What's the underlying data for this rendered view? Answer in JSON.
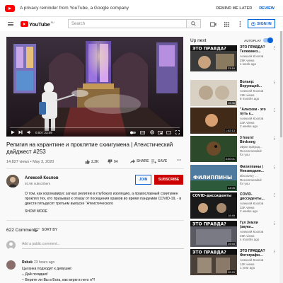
{
  "consent": {
    "message": "A privacy reminder from YouTube, a Google company",
    "remind_later": "REMIND ME LATER",
    "review": "REVIEW"
  },
  "masthead": {
    "logo_text": "YouTube",
    "logo_region": "RU",
    "search_placeholder": "Search",
    "sign_in": "SIGN IN"
  },
  "player": {
    "timecode": "0:00 / 23:49",
    "progress_fraction": 0.0
  },
  "video": {
    "title": "Религия на карантине и проклятие схиигумена | Атеистический дайджест #253",
    "meta": "14,827 views • May 3, 2020",
    "likes": "2.3K",
    "dislikes": "94",
    "share": "SHARE",
    "save": "SAVE"
  },
  "channel": {
    "name": "Алексей Козлов",
    "subscribers": "40.9K subscribers",
    "join": "JOIN",
    "subscribe": "SUBSCRIBE",
    "description": "О том, как коронавирус загнал религию в глубокую изоляцию, а православный схиигумен проклял тех, кто призывал к отказу от посещения храмов во время пандемии COVID-19, - в двести пятьдесят третьем выпуске \"Атеистического",
    "show_more": "SHOW MORE"
  },
  "comments": {
    "count": "622 Comments",
    "sort_by": "SORT BY",
    "placeholder": "Add a public comment...",
    "first": {
      "author": "Rebek",
      "time": "23 hours ago",
      "lines": [
        "Цыганка подходит к девушке:",
        "– Дай погадаю!",
        "– Верите ли Вы в Бога, как верю в него я?!"
      ]
    }
  },
  "sidebar": {
    "up_next": "Up next",
    "autoplay": "AUTOPLAY",
    "autoplay_on": true,
    "items": [
      {
        "title": "ЭТО ПРАВДА? Телекинез...",
        "channel": "Алексей Козлов",
        "views": "29K views",
        "age": "1 week ago",
        "duration": "23:18"
      },
      {
        "title": "Вольер: Верующий...",
        "channel": "Алексей Козлов",
        "views": "19K views",
        "age": "6 months ago",
        "duration": "15:36"
      },
      {
        "title": "\"Алисизм - это путь к...",
        "channel": "Алексей Козлов",
        "views": "33K views",
        "age": "2 weeks ago",
        "duration": "1:02:13"
      },
      {
        "title": "3 hours! Birdsong",
        "channel": "Звуки природ...",
        "views": "Recommended",
        "age": "for you",
        "duration": "3:00:01"
      },
      {
        "title": "Филиппины | Неизведанн...",
        "channel": "Discovery ...",
        "views": "Recommended",
        "age": "for you",
        "duration": "44:05"
      },
      {
        "title": "COVID-диссиденты...",
        "channel": "Алексей Козлов",
        "views": "33K views",
        "age": "2 weeks ago",
        "duration": "16:49"
      },
      {
        "title": "Гул Земли (звуки...",
        "channel": "Алексей Козлов",
        "views": "48K views",
        "age": "4 months ago",
        "duration": "19:55"
      },
      {
        "title": "ЭТО ПРАВДА? Фотографи...",
        "channel": "Алексей Козлов",
        "views": "12K views",
        "age": "1 year ago",
        "duration": "12:20"
      }
    ]
  }
}
